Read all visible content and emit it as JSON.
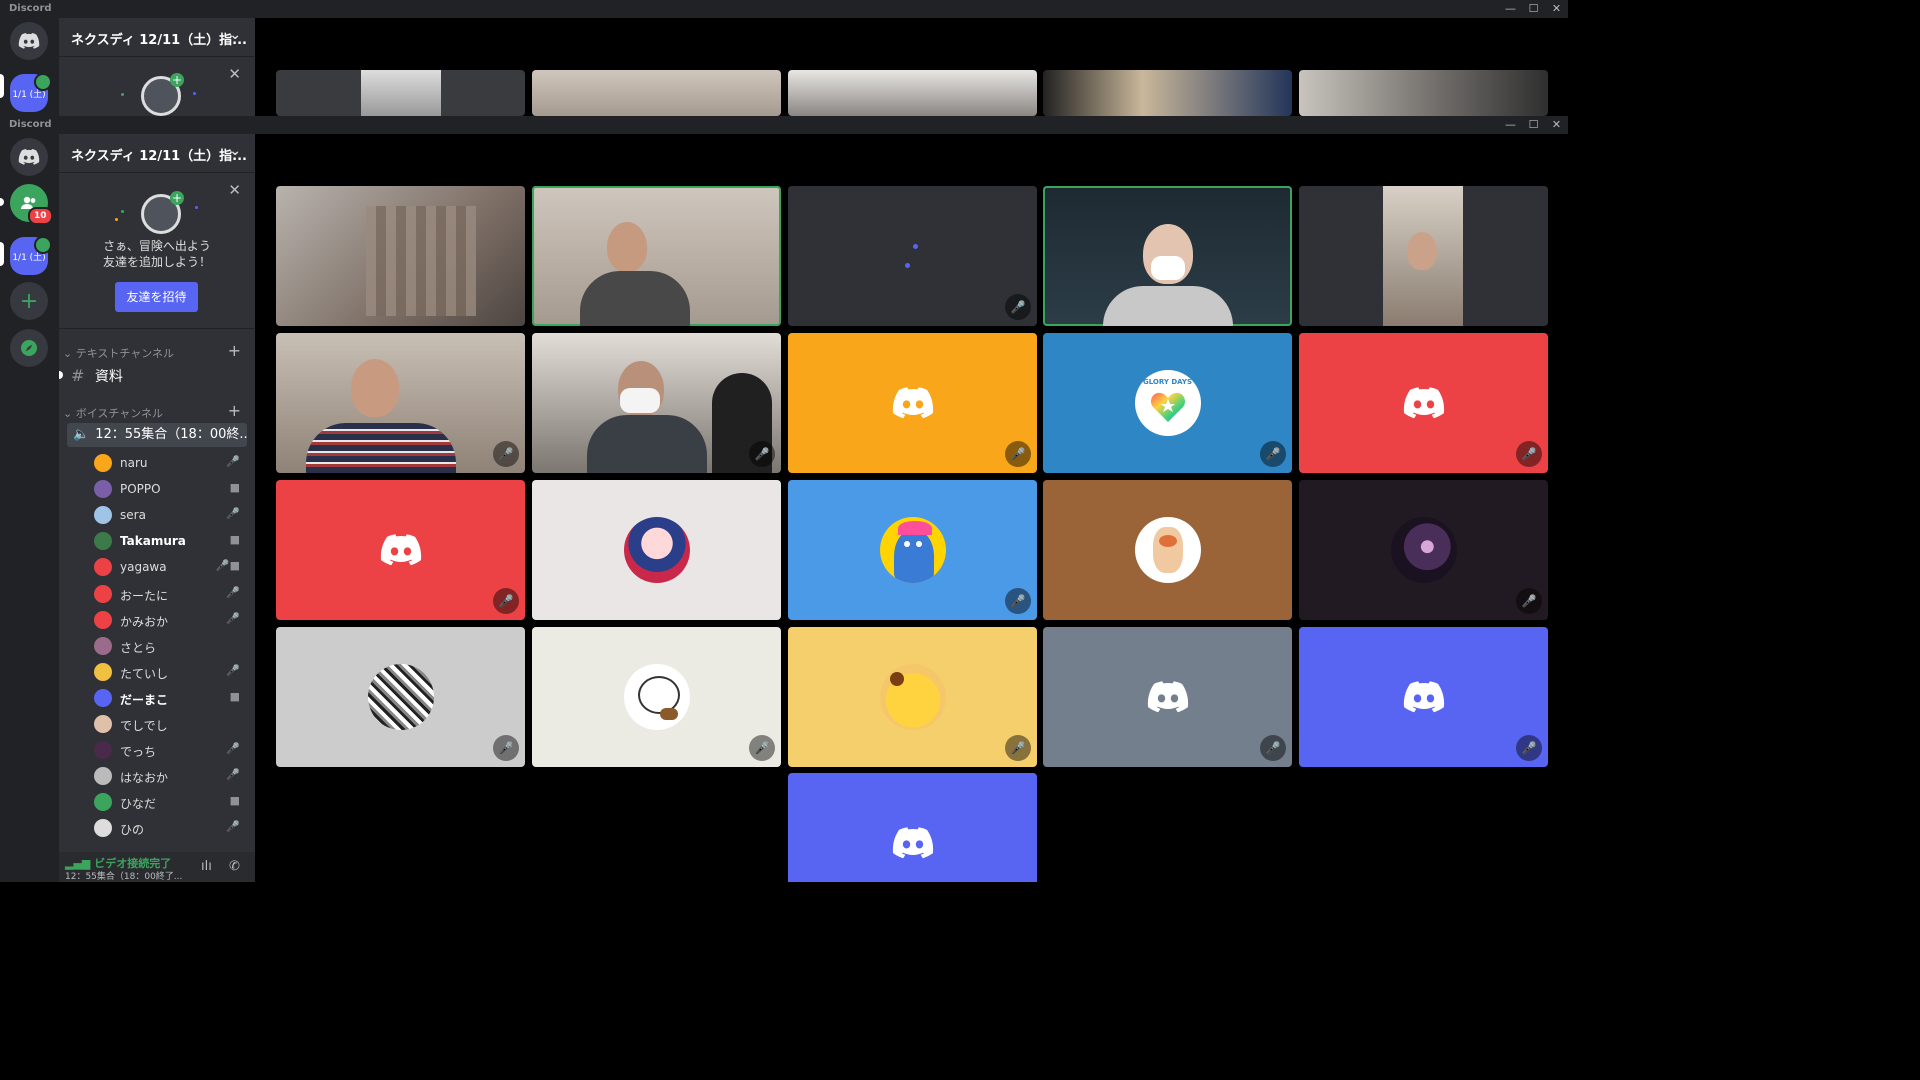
{
  "app": {
    "name": "Discord",
    "win_minimize": "—",
    "win_maximize": "☐",
    "win_close": "✕"
  },
  "server_rail": {
    "guild_label": "1/1 (土)",
    "friends_badge": "10"
  },
  "guild": {
    "name": "ネクスディ 12/11（土）指...",
    "chevron": "⌄"
  },
  "invite": {
    "line1": "さぁ、冒険へ出よう",
    "line2": "友達を追加しよう！",
    "button": "友達を招待",
    "close": "✕"
  },
  "categories": {
    "text": "テキストチャンネル",
    "voice": "ボイスチャンネル",
    "collapse": "⌄",
    "add": "+"
  },
  "text_channels": [
    {
      "name": "資料",
      "hash": "#"
    }
  ],
  "voice_channel": {
    "name": "12：55集合（18：00終...",
    "speaker_icon": "🔈"
  },
  "members": [
    {
      "name": "naru",
      "status": "🎤",
      "color": "#faa61a"
    },
    {
      "name": "POPPO",
      "status": "■",
      "color": "#7a5ea8"
    },
    {
      "name": "sera",
      "status": "🎤",
      "color": "#a0c4e8"
    },
    {
      "name": "Takamura",
      "status": "■",
      "color": "#3d7a4a"
    },
    {
      "name": "yagawa",
      "status": "🎤■",
      "color": "#ed4245"
    },
    {
      "name": "おーたに",
      "status": "🎤",
      "color": "#ed4245"
    },
    {
      "name": "かみおか",
      "status": "🎤",
      "color": "#ed4245"
    },
    {
      "name": "さとら",
      "status": "",
      "color": "#9a6b8a"
    },
    {
      "name": "たていし",
      "status": "🎤",
      "color": "#f0c040"
    },
    {
      "name": "だーまこ",
      "status": "■",
      "color": "#5865f2"
    },
    {
      "name": "でしでし",
      "status": "",
      "color": "#e0c0a8"
    },
    {
      "name": "でっち",
      "status": "🎤",
      "color": "#4a2a4a"
    },
    {
      "name": "はなおか",
      "status": "🎤",
      "color": "#bbbbbb"
    },
    {
      "name": "ひなだ",
      "status": "■",
      "color": "#3ba55d"
    },
    {
      "name": "ひの",
      "status": "🎤",
      "color": "#dddddd"
    }
  ],
  "voice_status": {
    "title": "ビデオ接続完了",
    "subtitle": "12：55集合（18：00終了...",
    "icon_soundboard": "ılı",
    "icon_disconnect": "✆"
  },
  "tiles": {
    "mute_icon": "🎤",
    "bgcolors": {
      "orange": "#faa61a",
      "blue_glory": "#2f86c4",
      "red": "#ed4245",
      "offwhite": "#ebe6e6",
      "blue": "#4a9ae8",
      "brown": "#9a6438",
      "dark": "#221a22",
      "lightgray": "#cccccc",
      "cream": "#ecebe3",
      "yellow": "#f5cf6b",
      "gray": "#747f8d",
      "blurple": "#5865f2",
      "empty": "#2f3136"
    },
    "glory_text": "GLORY DAYS"
  }
}
